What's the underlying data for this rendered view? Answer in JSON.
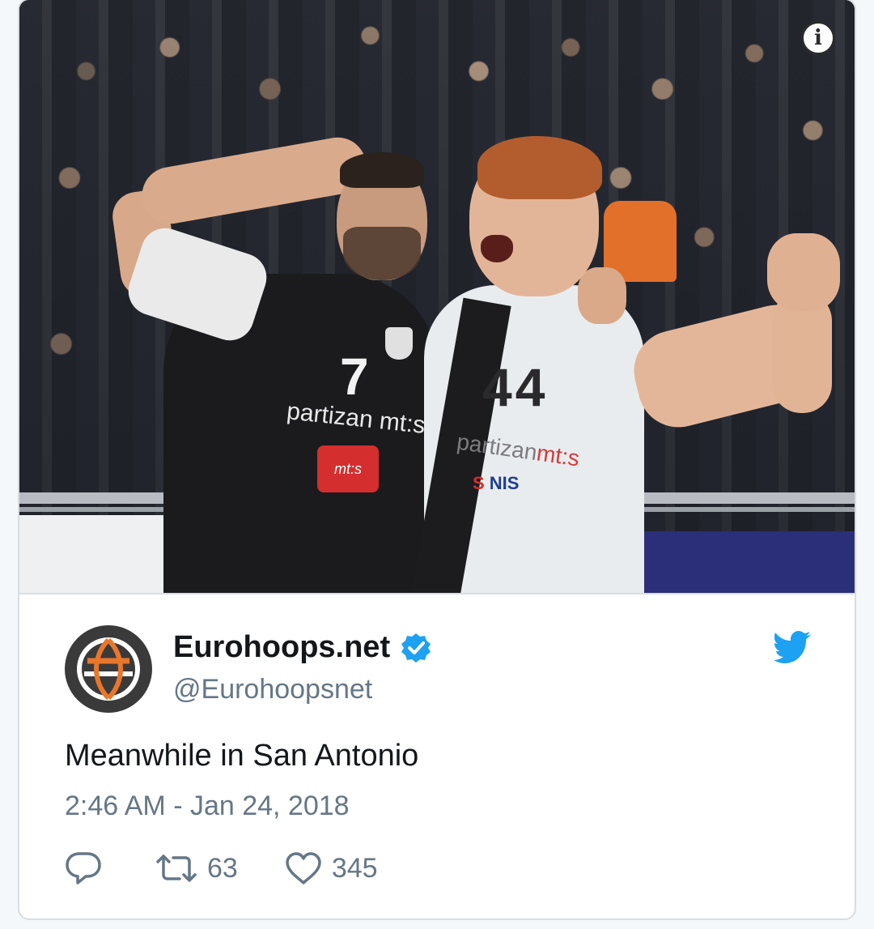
{
  "media": {
    "alt_kind": "photo",
    "info_label": "i"
  },
  "photo_text": {
    "left_number": "7",
    "left_sponsor": "partizan mt:s",
    "left_badge": "mt:s",
    "right_number": "44",
    "right_sponsor_main": "partizan",
    "right_sponsor_mts": "mt:s",
    "right_sponsor2": "NIS"
  },
  "author": {
    "display_name": "Eurohoops.net",
    "handle": "@Eurohoopsnet",
    "verified": true
  },
  "tweet": {
    "text": "Meanwhile in San Antonio",
    "timestamp": "2:46 AM - Jan 24, 2018"
  },
  "actions": {
    "reply_icon": "reply-icon",
    "retweet_icon": "retweet-icon",
    "retweet_count": "63",
    "like_icon": "heart-icon",
    "like_count": "345"
  },
  "colors": {
    "verified_blue": "#1da1f2",
    "twitter_blue": "#1da1f2",
    "muted_text": "#657786",
    "primary_text": "#14171a",
    "avatar_orange": "#e9772b"
  }
}
